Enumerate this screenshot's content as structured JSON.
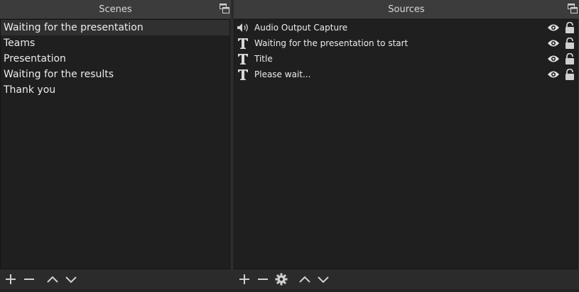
{
  "scenes": {
    "title": "Scenes",
    "items": [
      {
        "label": "Waiting for the presentation",
        "selected": true
      },
      {
        "label": "Teams"
      },
      {
        "label": "Presentation"
      },
      {
        "label": "Waiting for the results"
      },
      {
        "label": "Thank you"
      }
    ],
    "toolbar": [
      "add-icon",
      "remove-icon",
      "move-up-icon",
      "move-down-icon"
    ]
  },
  "sources": {
    "title": "Sources",
    "items": [
      {
        "label": "Audio Output Capture",
        "icon": "speaker-icon",
        "visible": true,
        "locked": true
      },
      {
        "label": "Waiting for the presentation to start",
        "icon": "text-icon",
        "visible": true,
        "locked": true
      },
      {
        "label": "Title",
        "icon": "text-icon",
        "visible": true,
        "locked": true
      },
      {
        "label": "Please wait...",
        "icon": "text-icon",
        "visible": true,
        "locked": true
      }
    ],
    "toolbar": [
      "add-icon",
      "remove-icon",
      "gear-icon",
      "move-up-icon",
      "move-down-icon"
    ]
  },
  "colors": {
    "panel": "#2b2b2b",
    "list": "#1f1f1f",
    "title_bar": "#3c3c3c",
    "selected": "#303030",
    "icon": "#d0d0d0"
  }
}
